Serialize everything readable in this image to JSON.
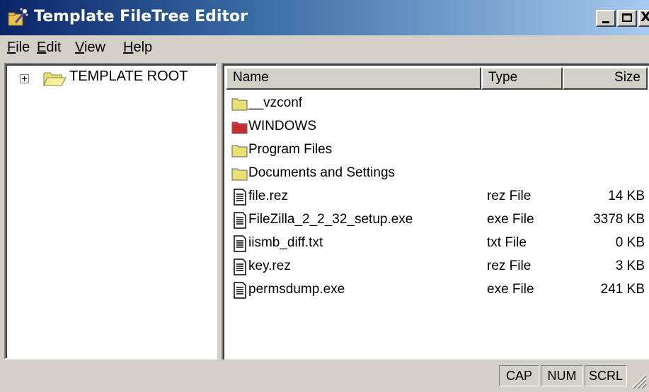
{
  "window": {
    "title": "Template FileTree Editor",
    "title_icon": "wand-app-icon",
    "controls": {
      "minimize": "minimize-button",
      "maximize": "maximize-button",
      "close_glyph": "X"
    }
  },
  "menu": {
    "items": [
      {
        "label_accel": "F",
        "label_rest": "ile"
      },
      {
        "label_accel": "E",
        "label_rest": "dit"
      },
      {
        "label_accel": "V",
        "label_rest": "iew"
      },
      {
        "label_accel": "H",
        "label_rest": "elp"
      }
    ]
  },
  "tree": {
    "root_label": "TEMPLATE ROOT",
    "expander": "plus",
    "icon": "open-folder-icon"
  },
  "list": {
    "columns": {
      "name": "Name",
      "type": "Type",
      "size": "Size"
    },
    "rows": [
      {
        "name": "__vzconf",
        "type": "",
        "size": "",
        "icon": "folder-icon",
        "color": "#e8e070"
      },
      {
        "name": "WINDOWS",
        "type": "",
        "size": "",
        "icon": "folder-icon",
        "color": "#e03030"
      },
      {
        "name": "Program Files",
        "type": "",
        "size": "",
        "icon": "folder-icon",
        "color": "#e8e070"
      },
      {
        "name": "Documents and Settings",
        "type": "",
        "size": "",
        "icon": "folder-icon",
        "color": "#e8e070"
      },
      {
        "name": "file.rez",
        "type": "rez File",
        "size": "14 KB",
        "icon": "document-icon"
      },
      {
        "name": "FileZilla_2_2_32_setup.exe",
        "type": "exe File",
        "size": "3378 KB",
        "icon": "document-icon"
      },
      {
        "name": "iismb_diff.txt",
        "type": "txt File",
        "size": "0 KB",
        "icon": "document-icon"
      },
      {
        "name": "key.rez",
        "type": "rez File",
        "size": "3 KB",
        "icon": "document-icon"
      },
      {
        "name": "permsdump.exe",
        "type": "exe File",
        "size": "241 KB",
        "icon": "document-icon"
      }
    ]
  },
  "status": {
    "cap": "CAP",
    "num": "NUM",
    "scrl": "SCRL"
  },
  "colors": {
    "titlebar_start": "#0a246a",
    "titlebar_end": "#a6caf0",
    "chrome": "#d4d0c8"
  }
}
